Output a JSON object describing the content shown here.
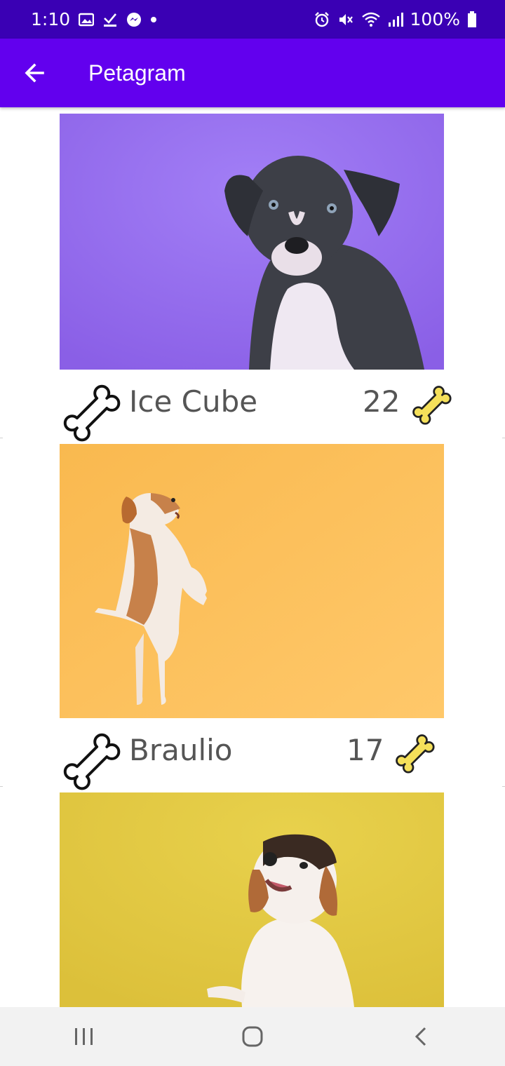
{
  "status_bar": {
    "time": "1:10",
    "battery": "100%",
    "left_icons": [
      "image-icon",
      "check-download-icon",
      "messenger-icon",
      "dot-icon"
    ],
    "right_icons": [
      "alarm-icon",
      "mute-icon",
      "wifi-icon",
      "signal-icon",
      "battery-icon"
    ]
  },
  "app_bar": {
    "title": "Petagram",
    "back_icon": "arrow-left-icon"
  },
  "pets": [
    {
      "name": "Ice Cube",
      "likes": "22",
      "photo_bg": "#9b70ee"
    },
    {
      "name": "Braulio",
      "likes": "17",
      "photo_bg": "#fbbd5f"
    },
    {
      "name": "",
      "likes": "",
      "photo_bg": "#e2c83e"
    }
  ],
  "colors": {
    "status_bar": "#3a00b4",
    "app_bar": "#6200ee",
    "bone_yellow": "#f5e05a"
  },
  "nav_bar": {
    "items": [
      "recent-apps-icon",
      "home-icon",
      "back-icon"
    ]
  }
}
